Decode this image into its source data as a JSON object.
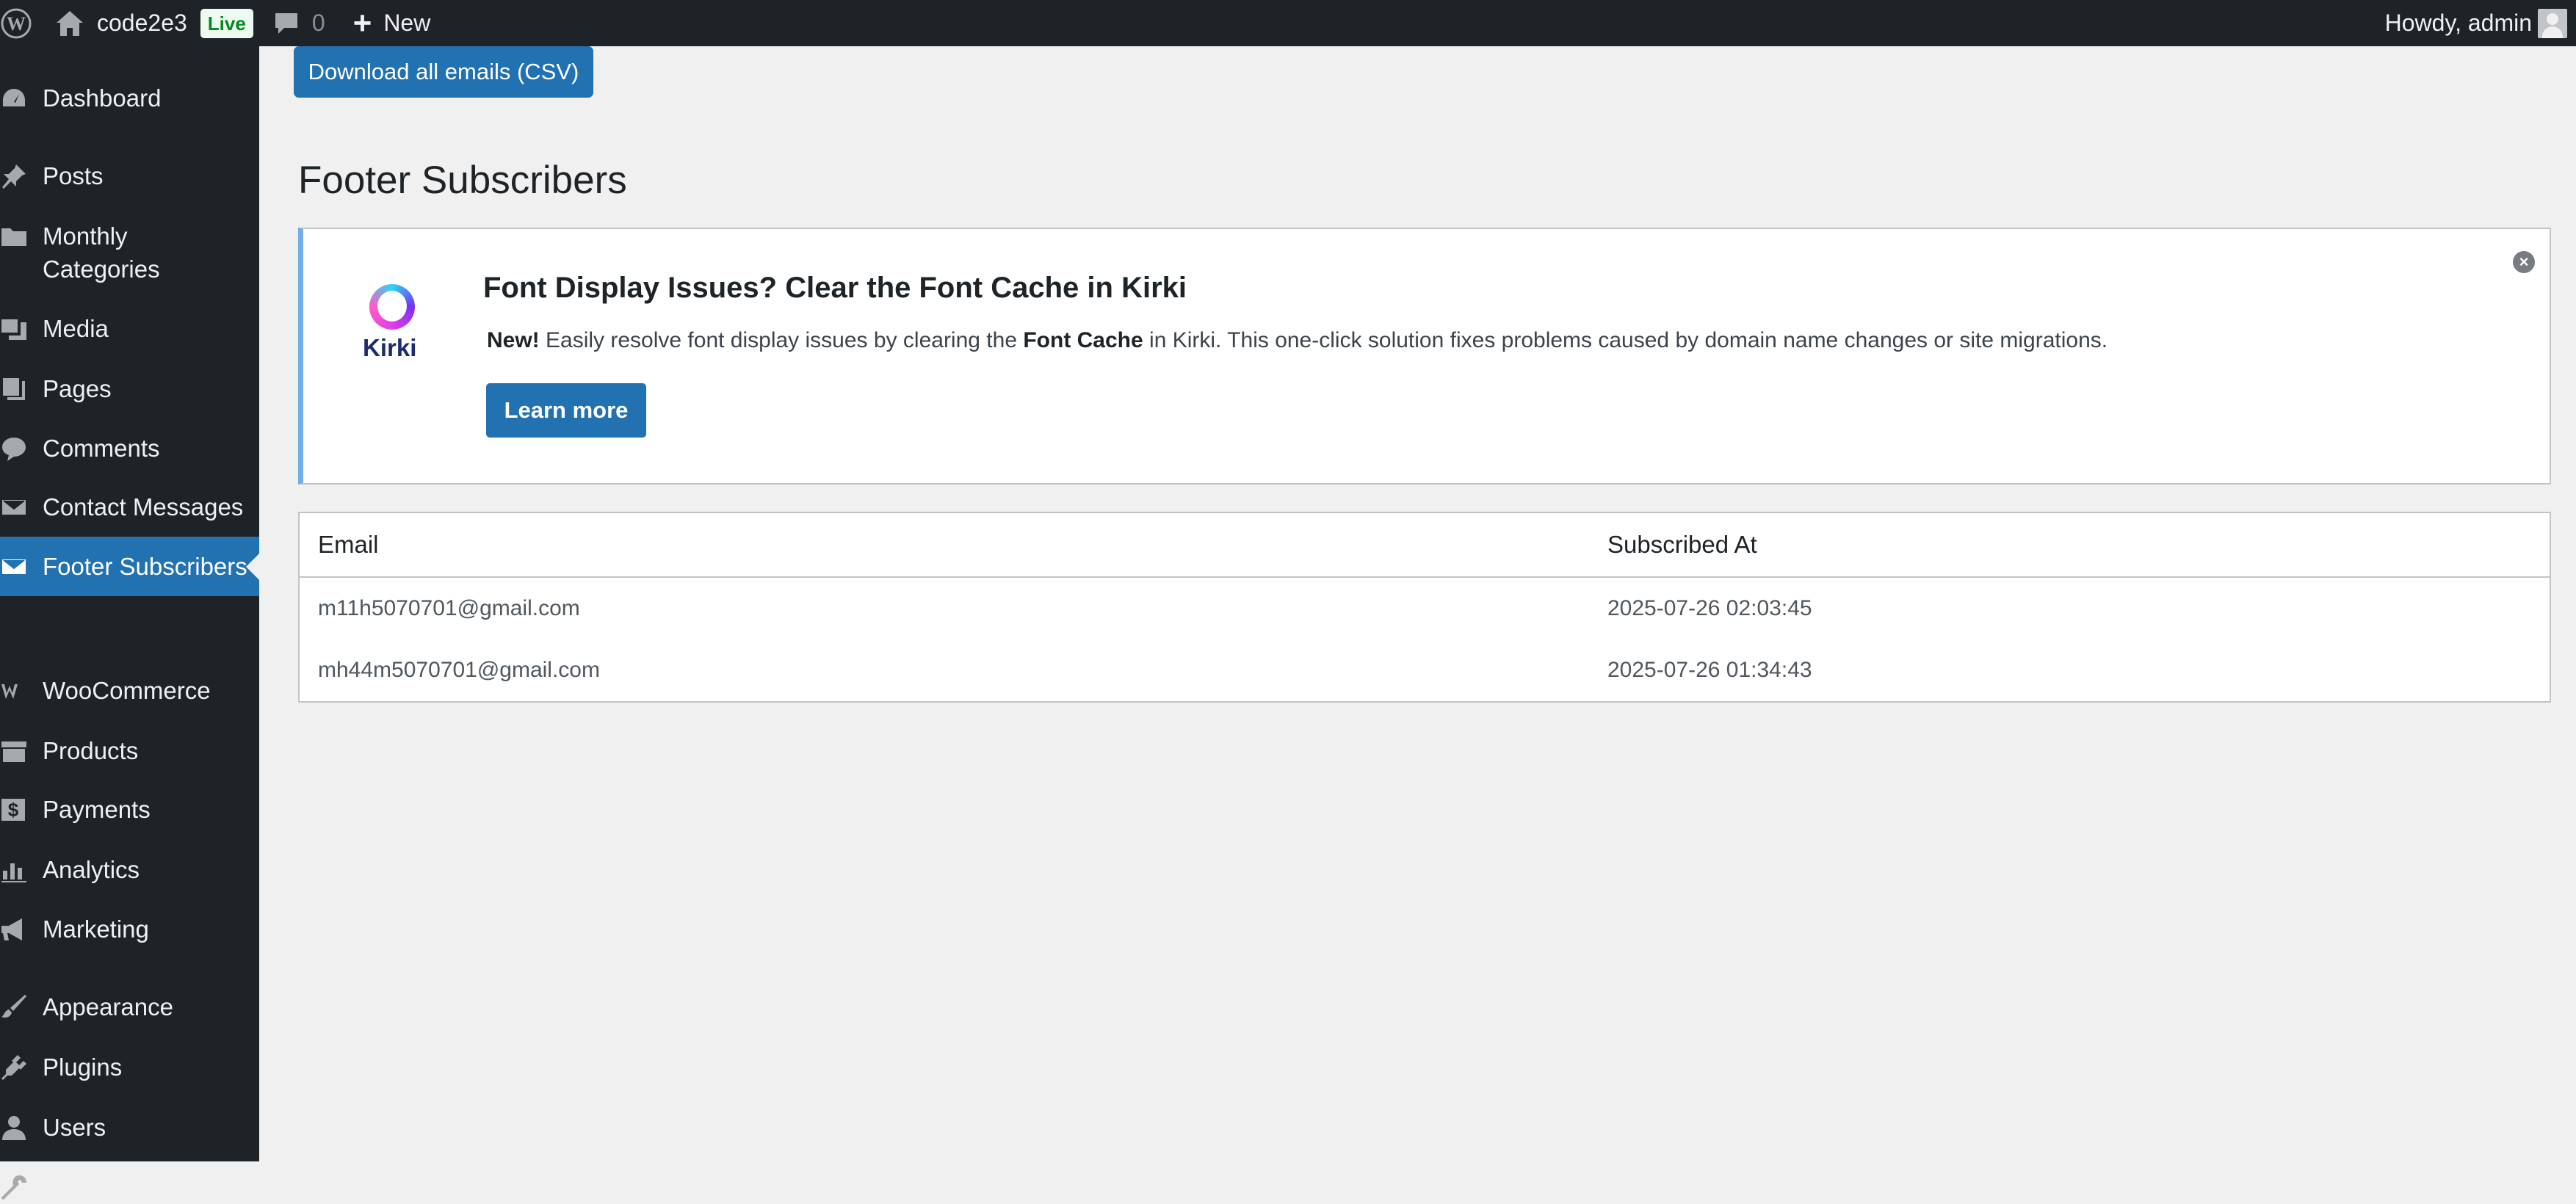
{
  "adminbar": {
    "site_name": "code2e3",
    "live_badge": "Live",
    "comments_count": "0",
    "new_label": "New",
    "howdy": "Howdy, admin"
  },
  "sidebar": {
    "items": [
      {
        "label": "Dashboard",
        "icon": "dashboard-icon"
      },
      {
        "label": "Posts",
        "icon": "pin-icon"
      },
      {
        "label": "Monthly",
        "label2": "Categories",
        "icon": "folder-icon"
      },
      {
        "label": "Media",
        "icon": "media-icon"
      },
      {
        "label": "Pages",
        "icon": "pages-icon"
      },
      {
        "label": "Comments",
        "icon": "comment-icon"
      },
      {
        "label": "Contact Messages",
        "icon": "envelope-icon"
      },
      {
        "label": "Footer Subscribers",
        "icon": "envelope-icon",
        "active": true
      },
      {
        "label": "WooCommerce",
        "icon": "woo-icon"
      },
      {
        "label": "Products",
        "icon": "archive-icon"
      },
      {
        "label": "Payments",
        "icon": "dollar-icon"
      },
      {
        "label": "Analytics",
        "icon": "chart-icon"
      },
      {
        "label": "Marketing",
        "icon": "megaphone-icon"
      },
      {
        "label": "Appearance",
        "icon": "brush-icon"
      },
      {
        "label": "Plugins",
        "icon": "plug-icon"
      },
      {
        "label": "Users",
        "icon": "user-icon"
      },
      {
        "label": "Tools",
        "icon": "wrench-icon"
      }
    ]
  },
  "main": {
    "download_button": "Download all emails (CSV)",
    "page_title": "Footer Subscribers",
    "notice": {
      "logo_text": "Kirki",
      "title": "Font Display Issues? Clear the Font Cache in Kirki",
      "text_new": "New!",
      "text_part1": " Easily resolve font display issues by clearing the ",
      "text_bold": "Font Cache",
      "text_part2": " in Kirki. This one-click solution fixes problems caused by domain name changes or site migrations.",
      "learn_more": "Learn more"
    },
    "table": {
      "headers": [
        "Email",
        "Subscribed At"
      ],
      "rows": [
        [
          "m11h5070701@gmail.com",
          "2025-07-26 02:03:45"
        ],
        [
          "mh44m5070701@gmail.com",
          "2025-07-26 01:34:43"
        ]
      ]
    }
  },
  "colors": {
    "admin_dark": "#1d2327",
    "accent": "#2271b1",
    "background": "#f0f0f1",
    "notice_border": "#72aee6",
    "live_green": "#008a20"
  }
}
